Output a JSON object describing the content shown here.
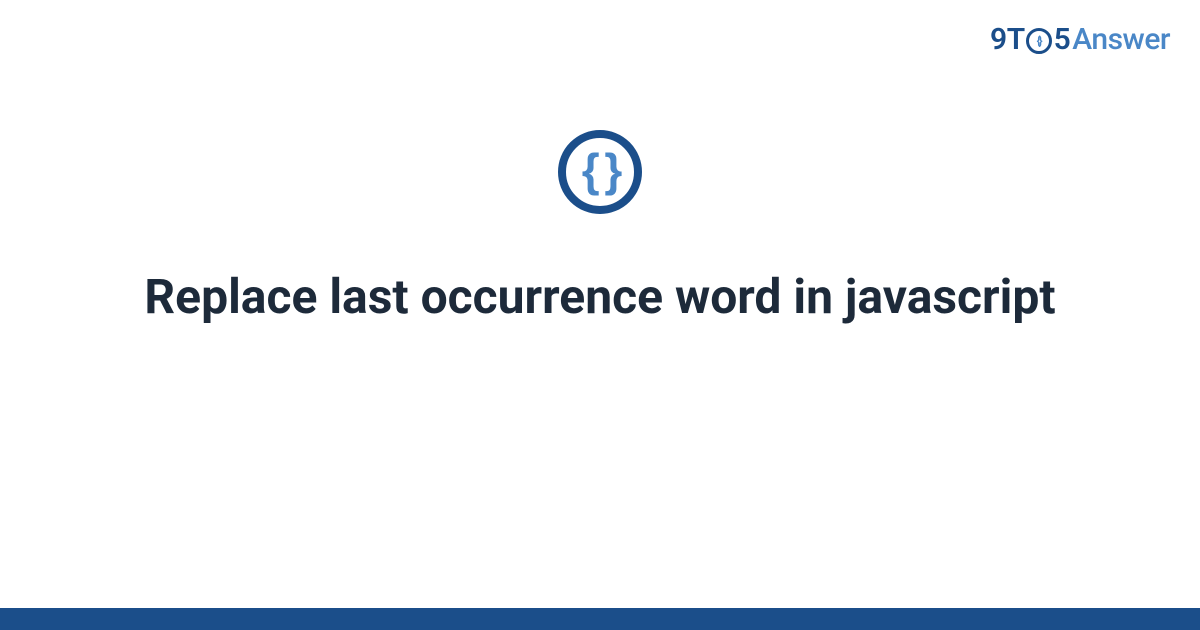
{
  "brand": {
    "prefix_nine": "9",
    "prefix_t": "T",
    "ring_glyph": "{}",
    "five": "5",
    "answer": "Answer"
  },
  "icon": {
    "name": "curly-braces-icon",
    "glyph": "{ }"
  },
  "title": "Replace last occurrence word in javascript",
  "colors": {
    "brand_dark": "#1b4e8a",
    "brand_light": "#4a87c7",
    "text": "#1d2a3a",
    "bg": "#ffffff"
  }
}
